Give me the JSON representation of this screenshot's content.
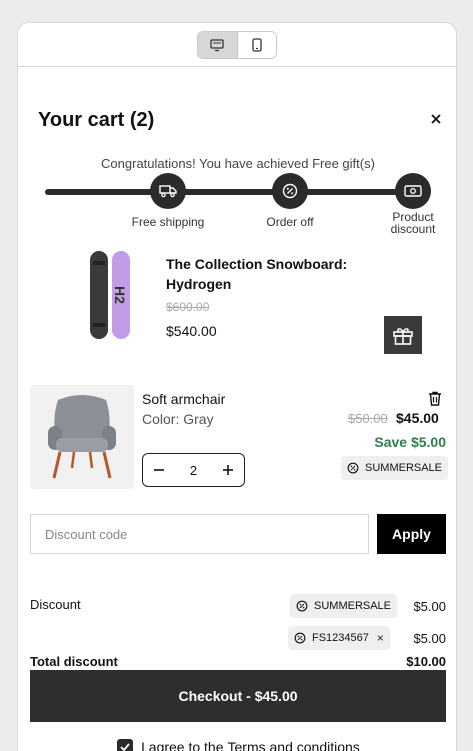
{
  "cart": {
    "title": "Your cart (2)"
  },
  "progress": {
    "message": "Congratulations! You have achieved Free gift(s)",
    "milestones": [
      {
        "label": "Free shipping",
        "icon": "truck-icon"
      },
      {
        "label": "Order off",
        "icon": "percent-badge-icon"
      },
      {
        "label_line1": "Product",
        "label_line2": "discount",
        "icon": "ticket-icon"
      }
    ]
  },
  "items": [
    {
      "title": "The Collection Snowboard: Hydrogen",
      "original_price": "$600.00",
      "price": "$540.00",
      "gift_icon": "gift-icon"
    },
    {
      "title": "Soft armchair",
      "variant": "Color: Gray",
      "original_price": "$50.00",
      "price": "$45.00",
      "savings": "Save $5.00",
      "discount_code": "SUMMERSALE",
      "quantity": "2"
    }
  ],
  "discount_form": {
    "placeholder": "Discount code",
    "apply_label": "Apply"
  },
  "summary": {
    "discount_label": "Discount",
    "codes": [
      {
        "code": "SUMMERSALE",
        "amount": "$5.00"
      },
      {
        "code": "FS1234567",
        "amount": "$5.00",
        "remove": "×"
      }
    ],
    "total_discount_label": "Total discount",
    "total_discount": "$10.00"
  },
  "checkout": {
    "label": "Checkout - $45.00"
  },
  "terms": {
    "prefix": "I agree to the",
    "link": "Terms and conditions"
  },
  "colors": {
    "dark": "#2b2b2b",
    "savings_green": "#2e7d4f",
    "chip_bg": "#efefef"
  }
}
